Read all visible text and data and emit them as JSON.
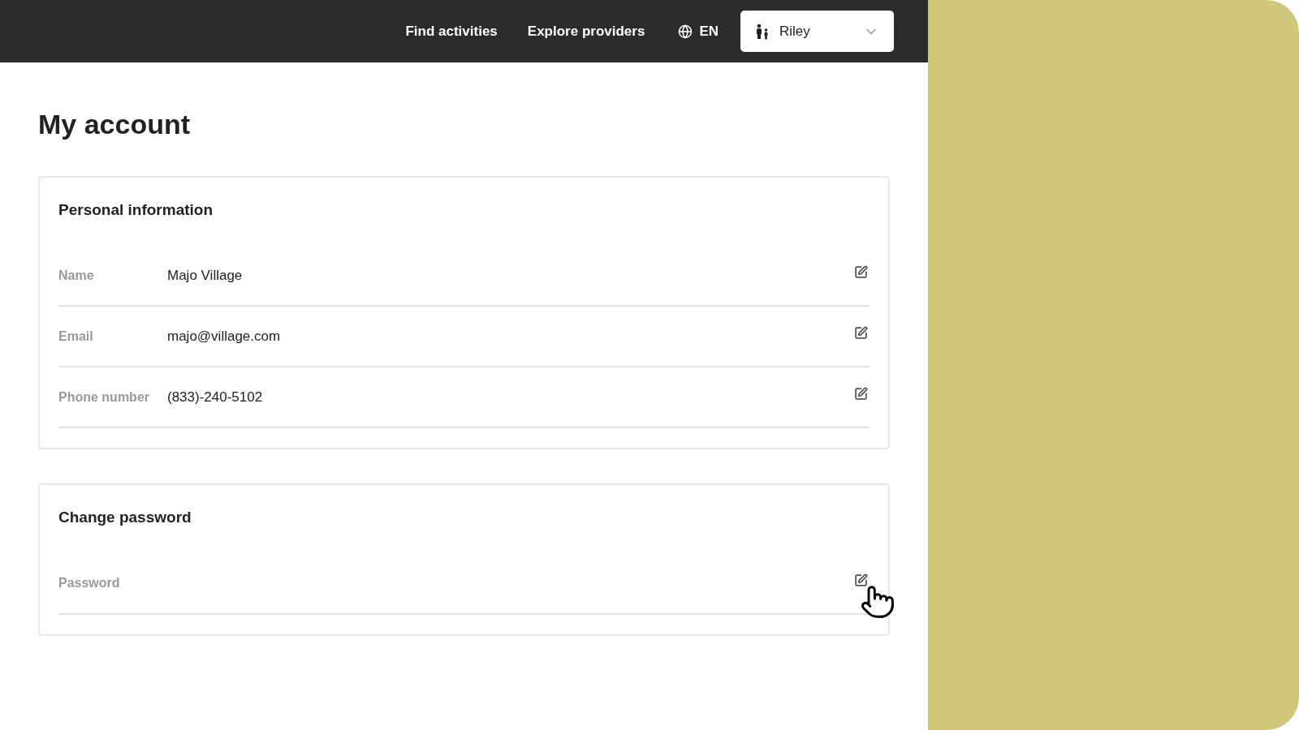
{
  "nav": {
    "links": [
      "Find activities",
      "Explore providers"
    ],
    "language": "EN",
    "user": "Riley"
  },
  "title": "My account",
  "sections": [
    {
      "title": "Personal information",
      "rows": [
        {
          "label": "Name",
          "value": "Majo Village"
        },
        {
          "label": "Email",
          "value": "majo@village.com"
        },
        {
          "label": "Phone number",
          "value": "(833)-240-5102"
        }
      ]
    },
    {
      "title": "Change password",
      "rows": [
        {
          "label": "Password"
        }
      ]
    }
  ]
}
